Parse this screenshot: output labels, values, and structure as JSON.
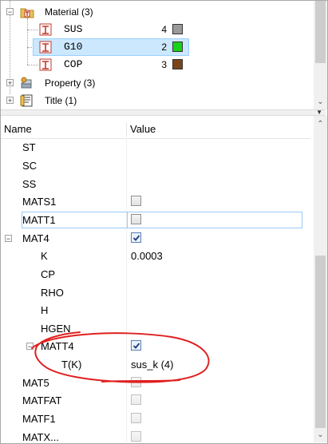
{
  "tree": {
    "items": [
      {
        "label": "Material (3)",
        "icon": "material-folder-icon",
        "expander": "−"
      },
      {
        "label": "SUS",
        "icon": "material-type-icon",
        "count": "4",
        "color": "#9a9a9a"
      },
      {
        "label": "G10",
        "icon": "material-type-icon",
        "count": "2",
        "color": "#19d219"
      },
      {
        "label": "COP",
        "icon": "material-type-icon",
        "count": "3",
        "color": "#7a4419"
      },
      {
        "label": "Property (3)",
        "icon": "property-icon",
        "expander": "+"
      },
      {
        "label": "Title (1)",
        "icon": "title-icon",
        "expander": "+"
      }
    ],
    "selected_color": "#cce8ff"
  },
  "grid": {
    "headers": {
      "name": "Name",
      "value": "Value"
    },
    "rows": [
      {
        "name": "ST",
        "value": ""
      },
      {
        "name": "SC",
        "value": ""
      },
      {
        "name": "SS",
        "value": ""
      },
      {
        "name": "MATS1",
        "value": "",
        "checkbox": "unchecked"
      },
      {
        "name": "MATT1",
        "value": "",
        "checkbox": "unchecked"
      },
      {
        "name": "MAT4",
        "value": "",
        "checkbox": "checked",
        "expander": "−"
      },
      {
        "name": "K",
        "value": "0.0003"
      },
      {
        "name": "CP",
        "value": ""
      },
      {
        "name": "RHO",
        "value": ""
      },
      {
        "name": "H",
        "value": ""
      },
      {
        "name": "HGEN",
        "value": ""
      },
      {
        "name": "MATT4",
        "value": "",
        "checkbox": "checked",
        "expander": "−"
      },
      {
        "name": "T(K)",
        "value": "sus_k (4)"
      },
      {
        "name": "MAT5",
        "value": "",
        "checkbox": "disabled"
      },
      {
        "name": "MATFAT",
        "value": "",
        "checkbox": "disabled"
      },
      {
        "name": "MATF1",
        "value": "",
        "checkbox": "disabled"
      },
      {
        "name": "MATX...",
        "value": "",
        "checkbox": "disabled"
      }
    ]
  },
  "annotation_color": "#e02020"
}
